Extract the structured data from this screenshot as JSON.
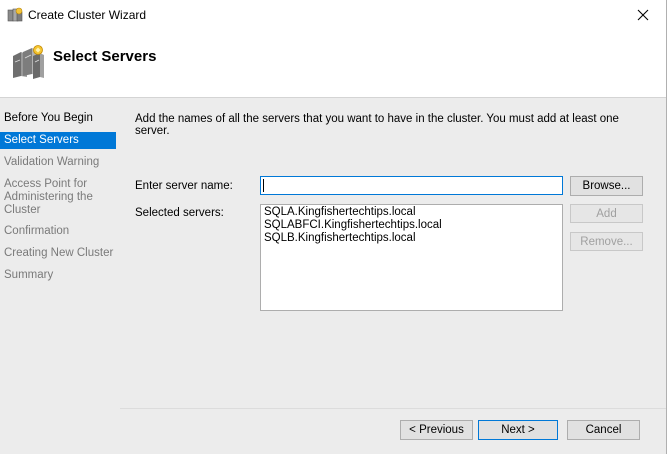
{
  "window": {
    "title": "Create Cluster Wizard",
    "title_icon": "cluster-wizard-icon",
    "close_icon": "close-icon"
  },
  "header": {
    "title": "Select Servers",
    "icon": "servers-icon"
  },
  "nav": {
    "items": [
      {
        "label": "Before You Begin",
        "state": "done"
      },
      {
        "label": "Select Servers",
        "state": "active"
      },
      {
        "label": "Validation Warning",
        "state": "pending"
      },
      {
        "label": "Access Point for Administering the Cluster",
        "state": "pending"
      },
      {
        "label": "Confirmation",
        "state": "pending"
      },
      {
        "label": "Creating New Cluster",
        "state": "pending"
      },
      {
        "label": "Summary",
        "state": "pending"
      }
    ]
  },
  "main": {
    "intro": "Add the names of all the servers that you want to have in the cluster. You must add at least one server.",
    "server_name_label": "Enter server name:",
    "server_name_value": "",
    "selected_label": "Selected servers:",
    "selected_servers": [
      "SQLA.Kingfishertechtips.local",
      "SQLABFCI.Kingfishertechtips.local",
      "SQLB.Kingfishertechtips.local"
    ],
    "browse_label": "Browse...",
    "add_label": "Add",
    "remove_label": "Remove..."
  },
  "footer": {
    "previous_label": "< Previous",
    "next_label": "Next >",
    "cancel_label": "Cancel"
  },
  "colors": {
    "accent": "#0078d7",
    "panel_bg": "#ececec",
    "disabled_text": "#a0a0a0"
  }
}
